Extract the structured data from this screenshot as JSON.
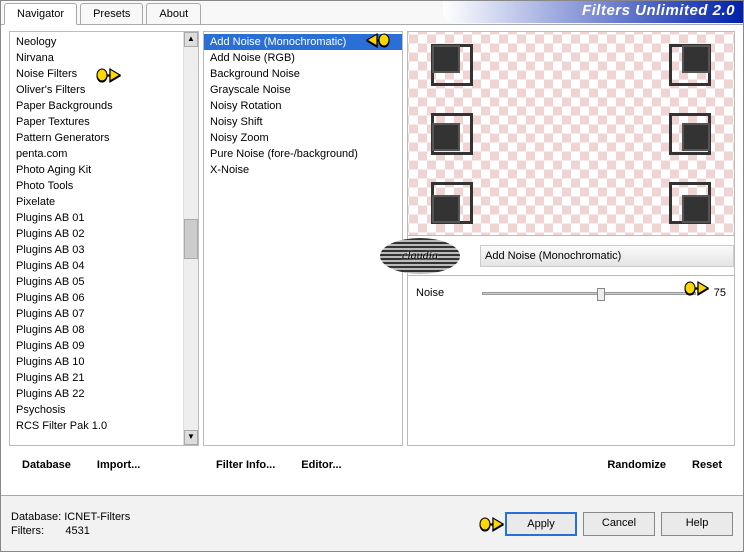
{
  "tabs": [
    "Navigator",
    "Presets",
    "About"
  ],
  "active_tab": 0,
  "brand": "Filters Unlimited 2.0",
  "categories": [
    "Neology",
    "Nirvana",
    "Noise Filters",
    "Oliver's Filters",
    "Paper Backgrounds",
    "Paper Textures",
    "Pattern Generators",
    "penta.com",
    "Photo Aging Kit",
    "Photo Tools",
    "Pixelate",
    "Plugins AB 01",
    "Plugins AB 02",
    "Plugins AB 03",
    "Plugins AB 04",
    "Plugins AB 05",
    "Plugins AB 06",
    "Plugins AB 07",
    "Plugins AB 08",
    "Plugins AB 09",
    "Plugins AB 10",
    "Plugins AB 21",
    "Plugins AB 22",
    "Psychosis",
    "RCS Filter Pak 1.0"
  ],
  "highlight_category_index": 2,
  "filters": [
    "Add Noise (Monochromatic)",
    "Add Noise (RGB)",
    "Background Noise",
    "Grayscale Noise",
    "Noisy Rotation",
    "Noisy Shift",
    "Noisy Zoom",
    "Pure Noise (fore-/background)",
    "X-Noise"
  ],
  "selected_filter_index": 0,
  "current_filter_title": "Add Noise (Monochromatic)",
  "watermark_text": "claudia",
  "params": [
    {
      "label": "Noise",
      "value": 75,
      "pct": 54
    }
  ],
  "cat_buttons": {
    "database": "Database",
    "import": "Import..."
  },
  "filter_buttons": {
    "info": "Filter Info...",
    "editor": "Editor..."
  },
  "param_buttons": {
    "randomize": "Randomize",
    "reset": "Reset"
  },
  "footer": {
    "db_label": "Database:",
    "db_name": "ICNET-Filters",
    "fl_label": "Filters:",
    "fl_count": "4531",
    "apply": "Apply",
    "cancel": "Cancel",
    "help": "Help"
  }
}
